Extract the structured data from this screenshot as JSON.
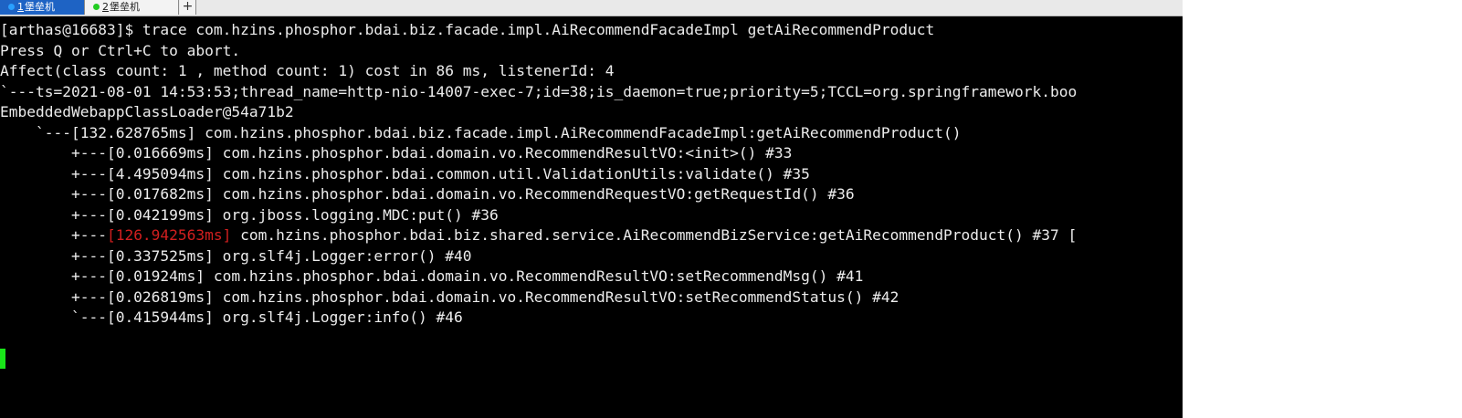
{
  "tabs": [
    {
      "number": "1",
      "label": "堡垒机",
      "active": true,
      "dot_color": "#2aa0ff"
    },
    {
      "number": "2",
      "label": "堡垒机",
      "active": false,
      "dot_color": "#22cc22"
    }
  ],
  "add_tab_symbol": "+",
  "terminal": {
    "lines": [
      "[arthas@16683]$ trace com.hzins.phosphor.bdai.biz.facade.impl.AiRecommendFacadeImpl getAiRecommendProduct",
      "Press Q or Ctrl+C to abort.",
      "Affect(class count: 1 , method count: 1) cost in 86 ms, listenerId: 4",
      "`---ts=2021-08-01 14:53:53;thread_name=http-nio-14007-exec-7;id=38;is_daemon=true;priority=5;TCCL=org.springframework.boo",
      "EmbeddedWebappClassLoader@54a71b2",
      "    `---[132.628765ms] com.hzins.phosphor.bdai.biz.facade.impl.AiRecommendFacadeImpl:getAiRecommendProduct()",
      "        +---[0.016669ms] com.hzins.phosphor.bdai.domain.vo.RecommendResultVO:<init>() #33",
      "        +---[4.495094ms] com.hzins.phosphor.bdai.common.util.ValidationUtils:validate() #35",
      "        +---[0.017682ms] com.hzins.phosphor.bdai.domain.vo.RecommendRequestVO:getRequestId() #36",
      "        +---[0.042199ms] org.jboss.logging.MDC:put() #36",
      "        +---",
      "        +---[0.337525ms] org.slf4j.Logger:error() #40",
      "        +---[0.01924ms] com.hzins.phosphor.bdai.domain.vo.RecommendResultVO:setRecommendMsg() #41",
      "        +---[0.026819ms] com.hzins.phosphor.bdai.domain.vo.RecommendResultVO:setRecommendStatus() #42",
      "        `---[0.415944ms] org.slf4j.Logger:info() #46"
    ],
    "hot_time": "[126.942563ms]",
    "hot_rest": " com.hzins.phosphor.bdai.biz.shared.service.AiRecommendBizService:getAiRecommendProduct() #37 [",
    "hot_color": "#d21f1f",
    "text_color": "#ececec",
    "background": "#000000",
    "cursor_color": "#19e619"
  }
}
